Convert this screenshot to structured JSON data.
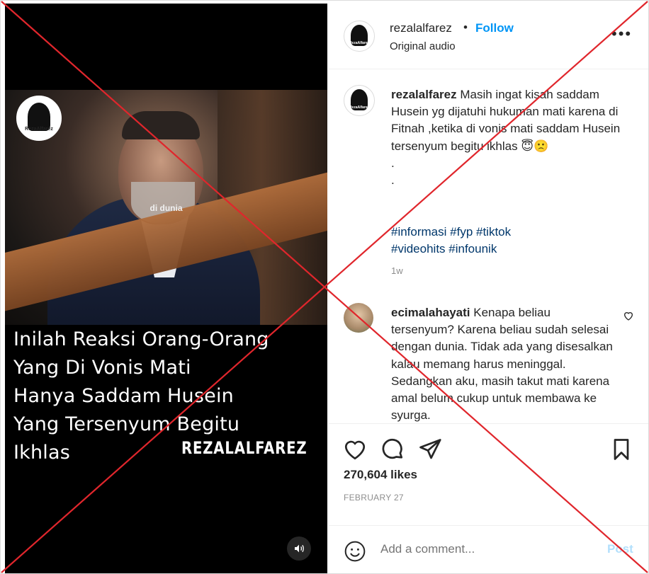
{
  "video": {
    "channel_badge": "RezaAlfarez",
    "frame_caption": "di dunia",
    "overlay_lines": [
      "Inilah Reaksi Orang-Orang",
      "Yang Di Vonis Mati",
      "Hanya Saddam Husein",
      "Yang Tersenyum Begitu",
      "Ikhlas"
    ],
    "watermark": "REZALALFAREZ",
    "sound_icon": "volume-icon"
  },
  "header": {
    "username": "rezalalfarez",
    "separator": "•",
    "follow_label": "Follow",
    "audio_label": "Original audio",
    "avatar_badge": "RezaAlfarez",
    "more_icon": "more-options-icon",
    "more_glyph": "•••"
  },
  "caption": {
    "username": "rezalalfarez",
    "text": "Masih ingat kisah saddam Husein yg dijatuhi hukuman mati karena di Fitnah ,ketika di vonis mati saddam Husein tersenyum begitu ikhlas 😇🙁",
    "dots": [
      ".",
      "."
    ],
    "hashtag_line1": "#informasi #fyp #tiktok",
    "hashtag_line2": "#videohits #infounik",
    "time": "1w"
  },
  "comment": {
    "username": "ecimalahayati",
    "text": "Kenapa beliau tersenyum? Karena beliau sudah selesai dengan dunia. Tidak ada yang disesalkan kalau memang harus meninggal. Sedangkan aku, masih takut mati karena amal belum cukup untuk membawa ke syurga."
  },
  "actions": {
    "likes": "270,604 likes",
    "date": "FEBRUARY 27",
    "icons": [
      "heart-icon",
      "comment-icon",
      "share-icon",
      "bookmark-icon"
    ]
  },
  "comment_bar": {
    "placeholder": "Add a comment...",
    "post_label": "Post"
  },
  "colors": {
    "accent": "#0095f6",
    "link": "#00376b",
    "cross": "#e0262c"
  }
}
